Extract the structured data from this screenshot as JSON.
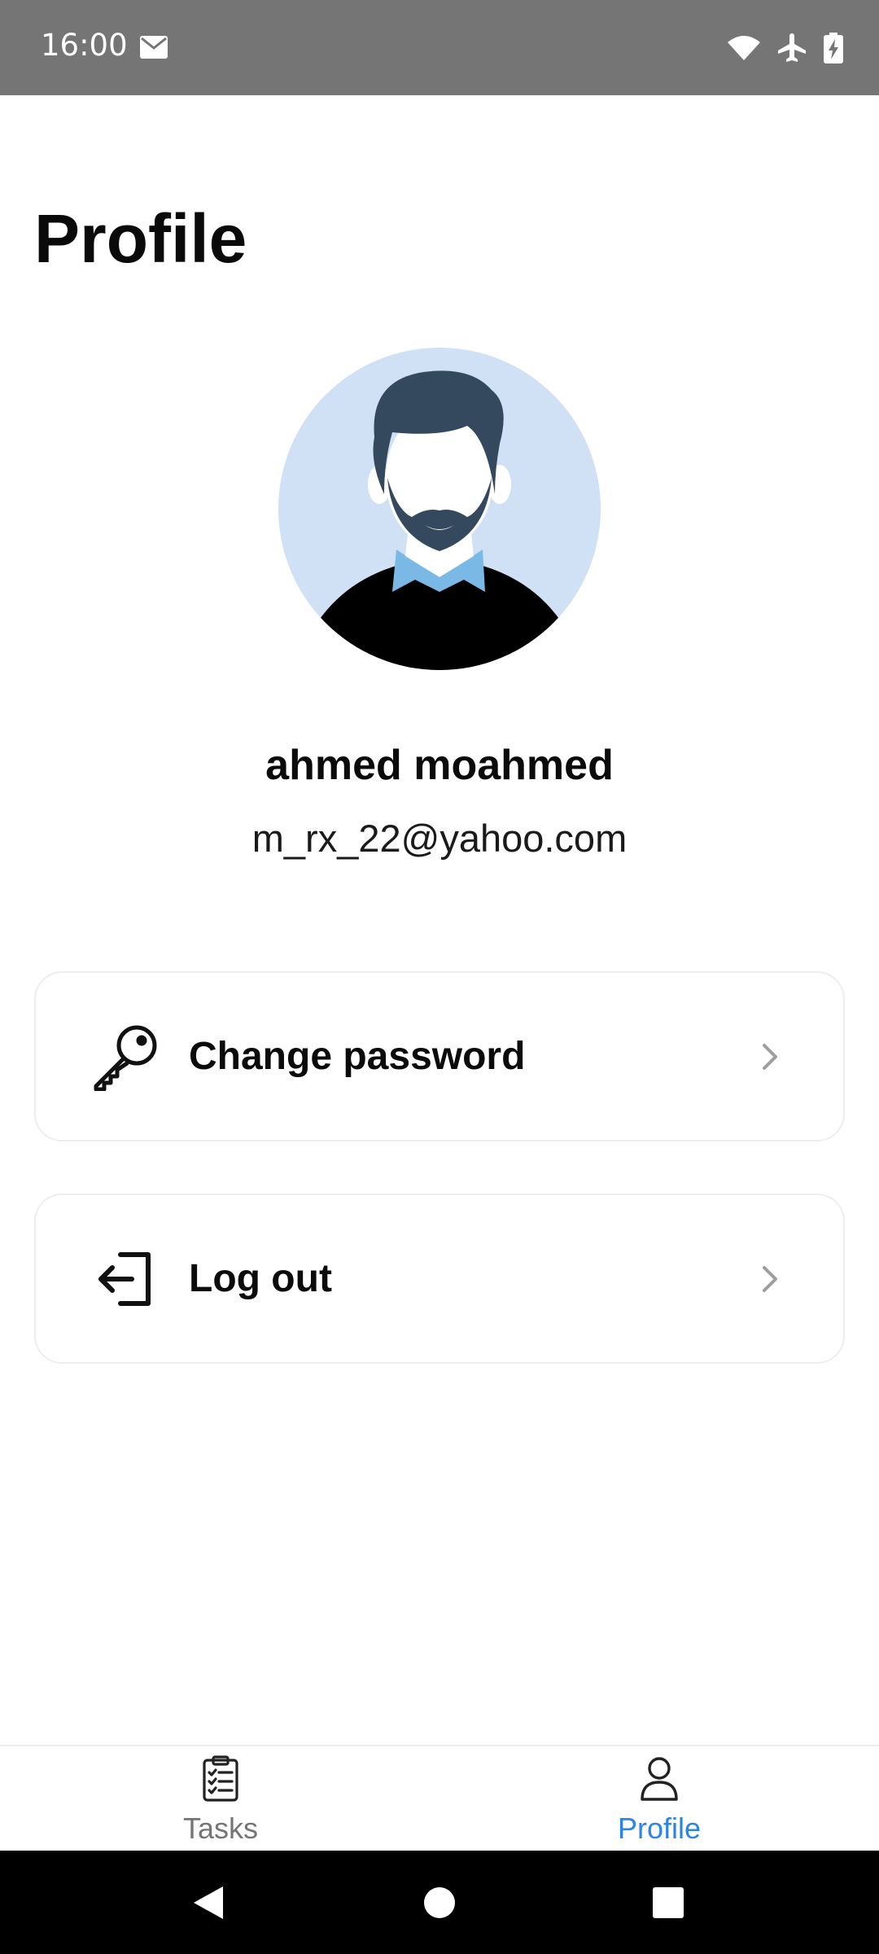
{
  "status_bar": {
    "time": "16:00",
    "icons": [
      "mail-icon",
      "wifi-icon",
      "airplane-icon",
      "battery-charging-icon"
    ]
  },
  "page": {
    "title": "Profile"
  },
  "user": {
    "name": "ahmed moahmed",
    "email": "m_rx_22@yahoo.com"
  },
  "menu": {
    "items": [
      {
        "label": "Change password",
        "icon": "key-icon"
      },
      {
        "label": "Log out",
        "icon": "logout-icon"
      }
    ]
  },
  "bottom_nav": {
    "tabs": [
      {
        "label": "Tasks",
        "icon": "clipboard-checklist-icon",
        "active": false
      },
      {
        "label": "Profile",
        "icon": "person-icon",
        "active": true
      }
    ]
  },
  "system_nav": {
    "buttons": [
      "back",
      "home",
      "recents"
    ]
  },
  "colors": {
    "accent": "#2b84e8",
    "status_bar": "#757575",
    "avatar_bg": "#d0e0f5"
  }
}
